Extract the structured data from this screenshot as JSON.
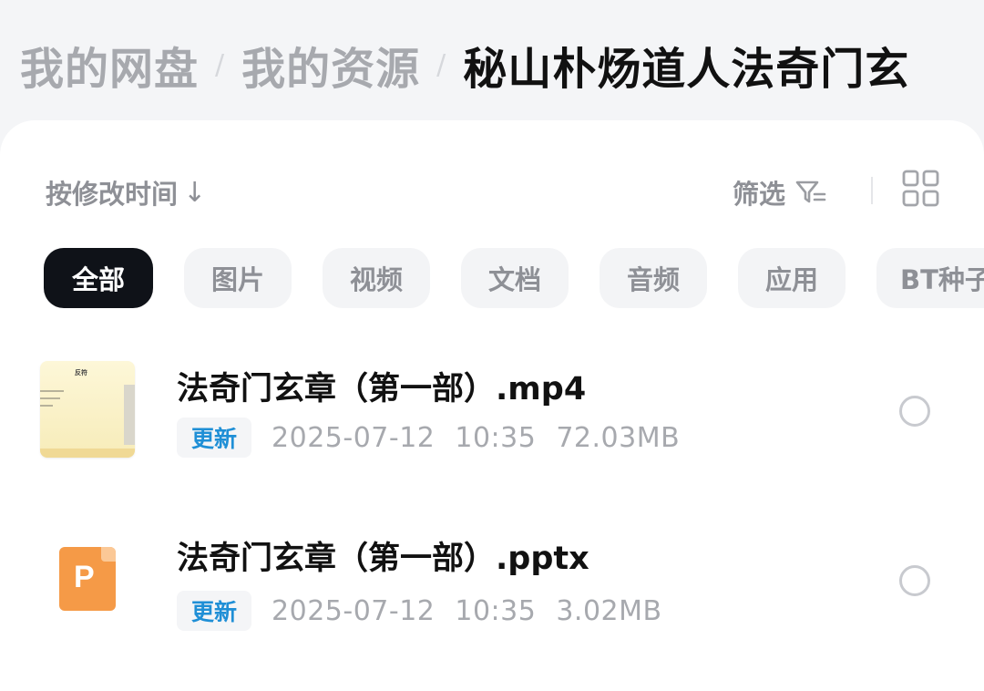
{
  "breadcrumb": {
    "items": [
      "我的网盘",
      "我的资源",
      "秘山朴炀道人法奇门玄"
    ],
    "separator": "/"
  },
  "toolbar": {
    "sort_label": "按修改时间",
    "sort_arrow": "↓",
    "filter_label": "筛选",
    "filter_icon": "filter-icon",
    "view_icon": "grid-view-icon"
  },
  "categories": {
    "items": [
      "全部",
      "图片",
      "视频",
      "文档",
      "音频",
      "应用",
      "BT种子"
    ],
    "active": "全部"
  },
  "files": [
    {
      "name": "法奇门玄章（第一部）.mp4",
      "tag": "更新",
      "date": "2025-07-12",
      "time": "10:35",
      "size": "72.03MB",
      "thumbnail_title": "反符"
    },
    {
      "name": "法奇门玄章（第一部）.pptx",
      "tag": "更新",
      "date": "2025-07-12",
      "time": "10:35",
      "size": "3.02MB",
      "icon_letter": "P"
    }
  ],
  "colors": {
    "accent_tag": "#1f8fd6",
    "active_chip": "#0f1218",
    "ppt_orange": "#f59a47"
  }
}
